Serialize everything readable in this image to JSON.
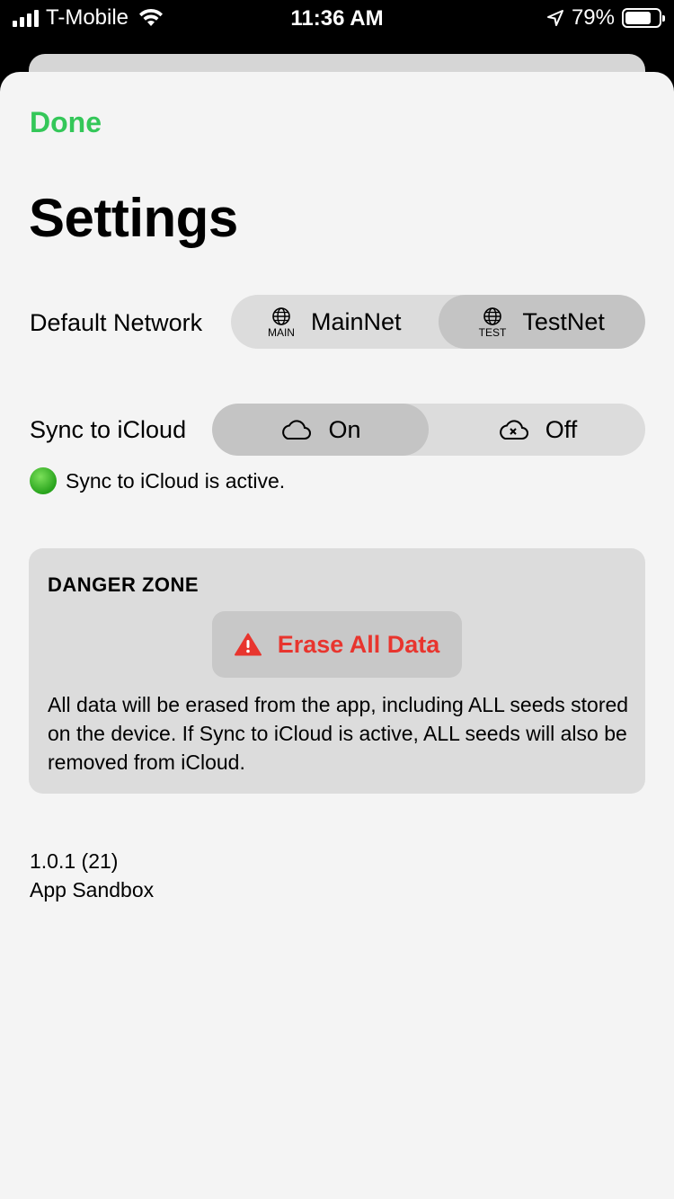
{
  "status_bar": {
    "carrier": "T-Mobile",
    "time": "11:36 AM",
    "battery_percent": "79%",
    "battery_level": 0.79
  },
  "nav": {
    "done_label": "Done"
  },
  "page": {
    "title": "Settings"
  },
  "default_network": {
    "label": "Default Network",
    "options": [
      {
        "label": "MainNet",
        "icon": "globe-icon",
        "tag": "MAIN",
        "selected": false
      },
      {
        "label": "TestNet",
        "icon": "globe-icon",
        "tag": "TEST",
        "selected": true
      }
    ]
  },
  "sync": {
    "label": "Sync to iCloud",
    "options": [
      {
        "label": "On",
        "icon": "cloud-icon",
        "selected": true
      },
      {
        "label": "Off",
        "icon": "cloud-x-icon",
        "selected": false
      }
    ],
    "status_text": "Sync to iCloud is active."
  },
  "danger_zone": {
    "title": "DANGER ZONE",
    "erase_label": "Erase All Data",
    "description": "All data will be erased from the app, including ALL seeds stored on the device. If Sync to iCloud is active, ALL seeds will also be removed from iCloud.",
    "accent_color": "#e8352e"
  },
  "footer": {
    "version": "1.0.1 (21)",
    "build_type": "App Sandbox"
  },
  "colors": {
    "accent": "#34c759",
    "danger": "#e8352e"
  }
}
